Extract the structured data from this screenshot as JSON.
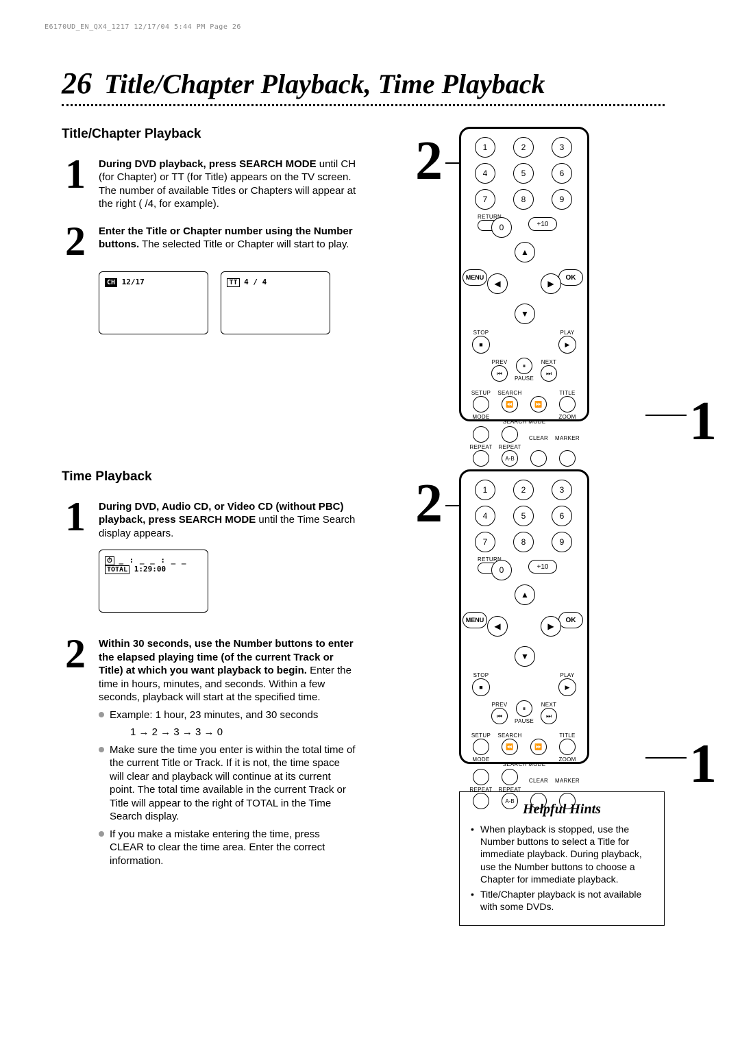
{
  "header_note": "E6170UD_EN_QX4_1217  12/17/04  5:44 PM  Page 26",
  "page_number": "26",
  "page_title": "Title/Chapter Playback, Time Playback",
  "section_a": {
    "heading": "Title/Chapter Playback",
    "step1_bold": "During DVD playback, press SEARCH MODE",
    "step1_rest": " until CH (for Chapter) or TT (for Title) appears on the TV screen. The number of available Titles or Chapters will appear at the right (  /4, for example).",
    "step2_bold": "Enter the Title or Chapter number using the Number buttons.",
    "step2_rest": " The selected Title or Chapter will start to play.",
    "osd_ch_label": "CH",
    "osd_ch_value": "12/17",
    "osd_tt_label": "TT",
    "osd_tt_value": "4 / 4"
  },
  "section_b": {
    "heading": "Time Playback",
    "step1_bold": "During DVD, Audio CD, or Video CD (without PBC) playback, press SEARCH MODE",
    "step1_rest": " until the Time Search display appears.",
    "osd_time_blanks": "_ : _ _ : _ _",
    "osd_total_label": "TOTAL",
    "osd_total_value": "1:29:00",
    "step2_bold": "Within 30 seconds, use the Number buttons to enter the elapsed playing time (of the current Track or Title) at which you want playback to begin.",
    "step2_rest": " Enter the time in hours, minutes, and seconds. Within a few seconds, playback will start at the specified time.",
    "example_label": "Example: 1 hour, 23 minutes, and 30 seconds",
    "example_keys": "1 → 2 → 3 → 3 → 0",
    "bullet2": "Make sure the time you enter is within the total time of the current Title or Track. If it is not, the time space will clear and playback will continue at its current point. The total time available in the current Track or Title will appear to the right of TOTAL in the Time Search display.",
    "bullet3": "If you make a mistake entering the time, press CLEAR to clear the time area. Enter the correct information."
  },
  "remote": {
    "keys": [
      "1",
      "2",
      "3",
      "4",
      "5",
      "6",
      "7",
      "8",
      "9",
      "0",
      "+10"
    ],
    "return": "RETURN",
    "menu": "MENU",
    "ok": "OK",
    "stop": "STOP",
    "play": "PLAY",
    "prev": "PREV",
    "pause": "PAUSE",
    "next": "NEXT",
    "setup": "SETUP",
    "search": "SEARCH",
    "title": "TITLE",
    "mode": "MODE",
    "search_mode": "SEARCH MODE",
    "zoom": "ZOOM",
    "repeat": "REPEAT",
    "repeat_ab": "REPEAT",
    "ab": "A-B",
    "clear": "CLEAR",
    "marker": "MARKER"
  },
  "hints": {
    "title": "Helpful Hints",
    "item1": "When playback is stopped, use the Number buttons to select a Title for immediate playback. During playback, use the Number buttons to choose a Chapter for immediate playback.",
    "item2": "Title/Chapter playback is not available with some DVDs."
  },
  "callouts": {
    "one": "1",
    "two": "2"
  }
}
